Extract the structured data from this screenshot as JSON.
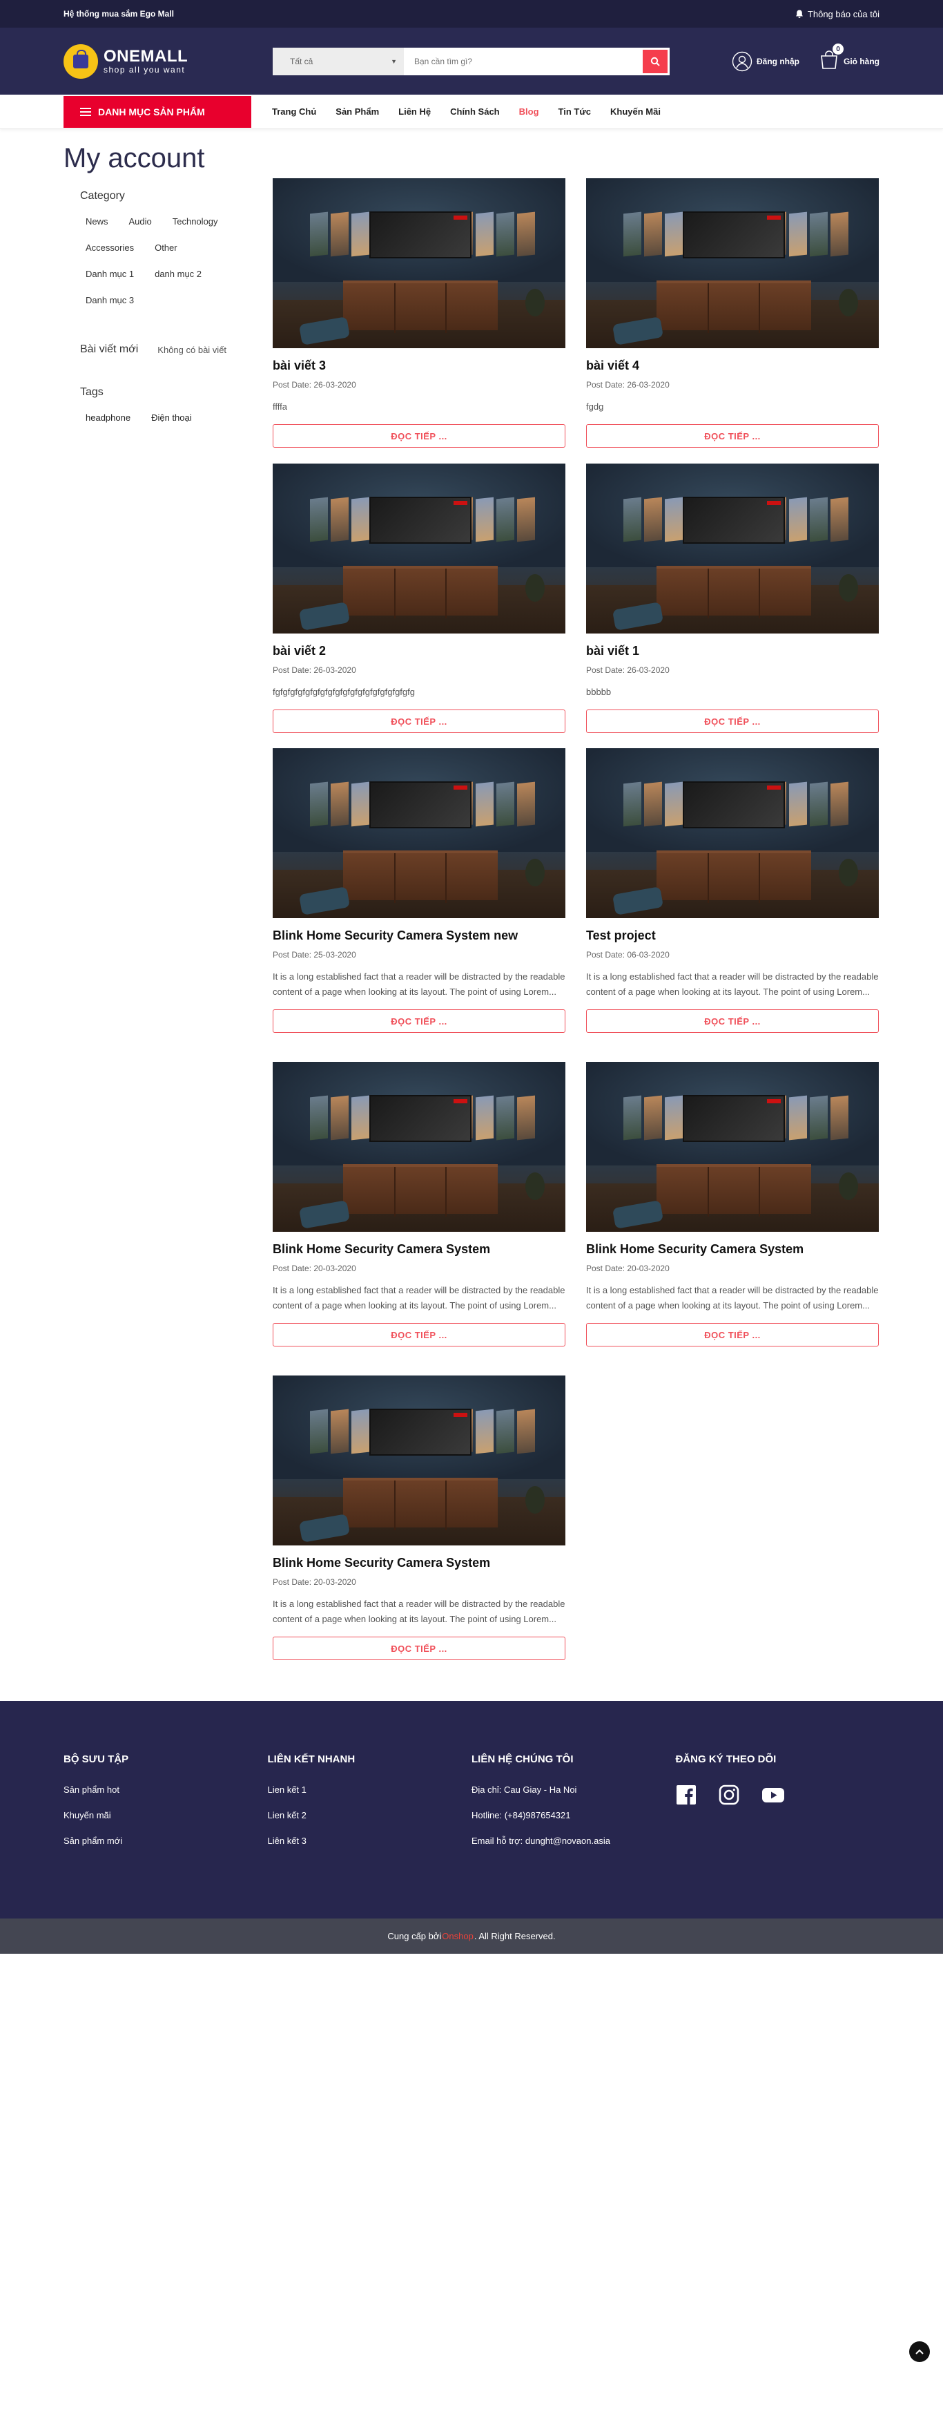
{
  "topbar": {
    "left_text": "Hệ thống mua sắm Ego Mall",
    "notify_label": "Thông báo của tôi"
  },
  "header": {
    "brand": "ONEMALL",
    "slogan": "shop all you want",
    "search_category": "Tất cả",
    "search_placeholder": "Bạn cần tìm gì?",
    "login_label": "Đăng nhập",
    "cart_label": "Giỏ hàng",
    "cart_count": "0"
  },
  "nav": {
    "category_label": "Danh mục sản phẩm",
    "items": [
      "Trang Chủ",
      "Sản Phẩm",
      "Liên Hệ",
      "Chính Sách",
      "Blog",
      "Tin Tức",
      "Khuyến Mãi"
    ],
    "active": "Blog"
  },
  "page": {
    "title": "My account"
  },
  "sidebar": {
    "category_heading": "Category",
    "categories": [
      "News",
      "Audio",
      "Technology",
      "Accessories",
      "Other",
      "Danh mục 1",
      "danh mục 2",
      "Danh mục 3"
    ],
    "newpost_heading": "Bài viết mới",
    "newpost_empty": "Không có bài viết",
    "tags_heading": "Tags",
    "tags": [
      "headphone",
      "Điện thoại"
    ]
  },
  "posts": [
    {
      "title": "bài viết 3",
      "date": "Post Date: 26-03-2020",
      "excerpt": "ffffa",
      "more": "ĐỌC TIẾP ..."
    },
    {
      "title": "bài viết 4",
      "date": "Post Date: 26-03-2020",
      "excerpt": "fgdg",
      "more": "ĐỌC TIẾP ..."
    },
    {
      "title": "bài viết 2",
      "date": "Post Date: 26-03-2020",
      "excerpt": "fgfgfgfgfgfgfgfgfgfgfgfgfgfgfgfgfgfgfg",
      "more": "ĐỌC TIẾP ..."
    },
    {
      "title": "bài viết 1",
      "date": "Post Date: 26-03-2020",
      "excerpt": "bbbbb",
      "more": "ĐỌC TIẾP ..."
    },
    {
      "title": "Blink Home Security Camera System new",
      "date": "Post Date: 25-03-2020",
      "excerpt": "It is a long established fact that a reader will be distracted by the readable content of a page when looking at its layout. The point of using Lorem...",
      "more": "ĐỌC TIẾP ..."
    },
    {
      "title": "Test project",
      "date": "Post Date: 06-03-2020",
      "excerpt": "It is a long established fact that a reader will be distracted by the readable content of a page when looking at its layout. The point of using Lorem...",
      "more": "ĐỌC TIẾP ..."
    },
    {
      "title": "Blink Home Security Camera System",
      "date": "Post Date: 20-03-2020",
      "excerpt": "It is a long established fact that a reader will be distracted by the readable content of a page when looking at its layout. The point of using Lorem...",
      "more": "ĐỌC TIẾP ..."
    },
    {
      "title": "Blink Home Security Camera System",
      "date": "Post Date: 20-03-2020",
      "excerpt": "It is a long established fact that a reader will be distracted by the readable content of a page when looking at its layout. The point of using Lorem...",
      "more": "ĐỌC TIẾP ..."
    },
    {
      "title": "Blink Home Security Camera System",
      "date": "Post Date: 20-03-2020",
      "excerpt": "It is a long established fact that a reader will be distracted by the readable content of a page when looking at its layout. The point of using Lorem...",
      "more": "ĐỌC TIẾP ..."
    }
  ],
  "footer": {
    "col1": {
      "heading": "Bộ sưu tập",
      "links": [
        "Sản phẩm hot",
        "Khuyến mãi",
        "Sản phẩm mới"
      ]
    },
    "col2": {
      "heading": "Liên kết nhanh",
      "links": [
        "Lien kết 1",
        "Lien kết 2",
        "Liên kết 3"
      ]
    },
    "col3": {
      "heading": "Liên hệ chúng tôi",
      "lines": [
        "Địa chỉ: Cau Giay - Ha Noi",
        "Hotline: (+84)987654321",
        "Email hỗ trợ: dunght@novaon.asia"
      ]
    },
    "col4": {
      "heading": "Đăng ký theo dõi",
      "social": [
        "facebook-icon",
        "instagram-icon",
        "youtube-icon"
      ]
    }
  },
  "copyright": {
    "prefix": "Cung cấp bởi ",
    "brand": "Onshop",
    "suffix": ". All Right Reserved."
  },
  "colors": {
    "primary_dark": "#2a2a52",
    "accent_red": "#e8002d",
    "link_red": "#f0505a",
    "logo_yellow": "#f7c316"
  }
}
